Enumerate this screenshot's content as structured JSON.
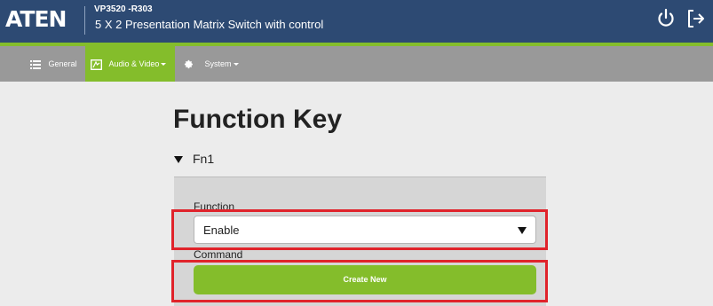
{
  "header": {
    "logo": "ATEN",
    "model": "VP3520 -R303",
    "subtitle": "5 X 2 Presentation Matrix Switch with control",
    "icons": [
      "power-icon",
      "logout-icon"
    ]
  },
  "nav": {
    "items": [
      {
        "label": "General",
        "icon": "list-icon",
        "dropdown": false,
        "active": false
      },
      {
        "label": "Audio & Video",
        "icon": "av-icon",
        "dropdown": true,
        "active": true
      },
      {
        "label": "System",
        "icon": "gear-icon",
        "dropdown": true,
        "active": false
      }
    ]
  },
  "main": {
    "title": "Function Key",
    "section": {
      "label": "Fn1",
      "expanded": true
    },
    "function_label": "Function",
    "function_value": "Enable",
    "command_label": "Command",
    "create_button": "Create New"
  },
  "colors": {
    "header_bg": "#2d4a73",
    "accent": "#84bd2b",
    "nav_bg": "#999999",
    "highlight": "#e0232b"
  }
}
